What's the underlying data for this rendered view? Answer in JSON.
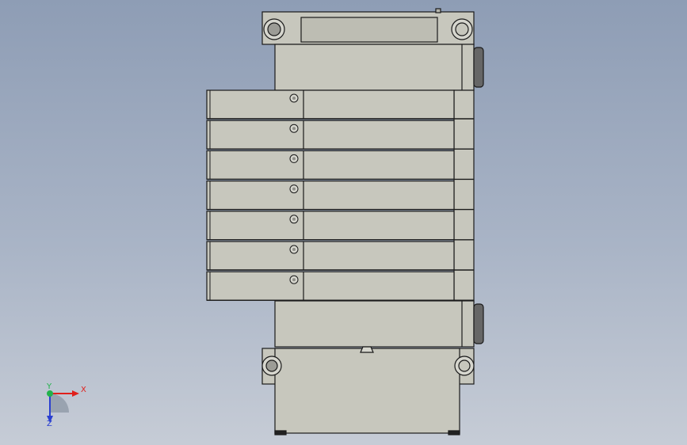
{
  "viewport": {
    "background_top": "#8e9db5",
    "background_bottom": "#c6ccd6"
  },
  "model": {
    "description_icon": "cad-assembly",
    "body_color": "#c7c7bd",
    "edge_color": "#1a1a1a",
    "valve_station_count": 7
  },
  "triad": {
    "x_label": "X",
    "y_label": "Y",
    "z_label": "Z",
    "x_color": "#e0201c",
    "y_color": "#22b24c",
    "z_color": "#2a3fd0"
  }
}
